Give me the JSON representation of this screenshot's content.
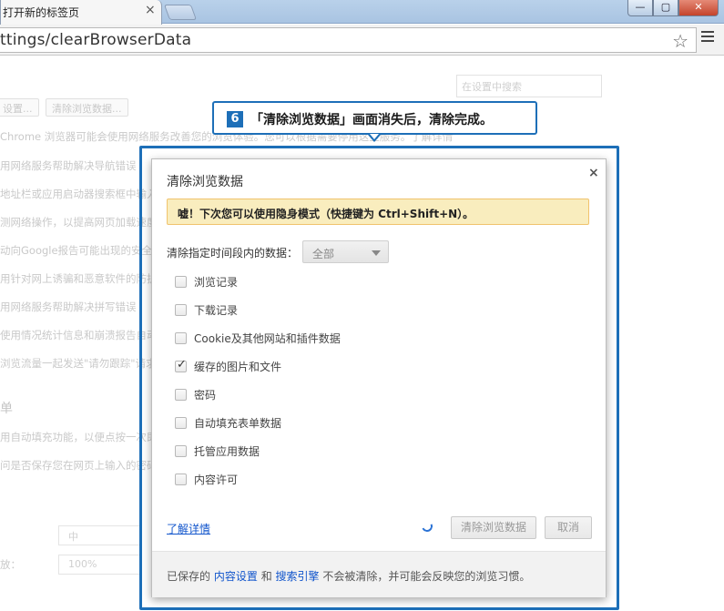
{
  "tab": {
    "title": "打开新的标签页",
    "close": "×"
  },
  "window": {
    "minimize": "—",
    "maximize": "▢",
    "close": "✕"
  },
  "address": {
    "url": "ttings/clearBrowserData"
  },
  "background": {
    "search_placeholder": "在设置中搜索",
    "btn1": "设置...",
    "btn2": "清除浏览数据...",
    "lines": [
      "Chrome 浏览器可能会使用网络服务改善您的浏览体验。您可以根据需要停用这些服务。了解详情",
      "用网络服务帮助解决导航错误",
      "地址栏或应用启动器搜索框中输入",
      "测网络操作，以提高网页加载速度",
      "动向Google报告可能出现的安全",
      "用针对网上诱骗和恶意软件的防护",
      "用网络服务帮助解决拼写错误",
      "使用情况统计信息和崩溃报告自动",
      "浏览流量一起发送\"请勿跟踪\"请求"
    ],
    "section_heading": "单",
    "autofill_lines": [
      "用自动填充功能，以便点按一次即",
      "问是否保存您在网页上输入的密码"
    ],
    "font_size_label": "中",
    "zoom_label": "放：",
    "zoom_value": "100%"
  },
  "callout": {
    "number": "6",
    "text": "「清除浏览数据」画面消失后，清除完成。"
  },
  "dialog": {
    "title": "清除浏览数据",
    "close": "×",
    "tip": "嘘！下次您可以使用隐身模式（快捷键为 Ctrl+Shift+N）。",
    "period_label": "清除指定时间段内的数据：",
    "period_value": "全部",
    "options": [
      {
        "label": "浏览记录",
        "checked": false
      },
      {
        "label": "下载记录",
        "checked": false
      },
      {
        "label": "Cookie及其他网站和插件数据",
        "checked": false
      },
      {
        "label": "缓存的图片和文件",
        "checked": true
      },
      {
        "label": "密码",
        "checked": false
      },
      {
        "label": "自动填充表单数据",
        "checked": false
      },
      {
        "label": "托管应用数据",
        "checked": false
      },
      {
        "label": "内容许可",
        "checked": false
      }
    ],
    "learn_more": "了解详情",
    "clear_button": "清除浏览数据",
    "cancel_button": "取消",
    "footer": {
      "prefix": "已保存的",
      "content_settings": "内容设置",
      "and": "和",
      "search_engines": "搜索引擎",
      "suffix": "不会被清除，并可能会反映您的浏览习惯。"
    }
  }
}
